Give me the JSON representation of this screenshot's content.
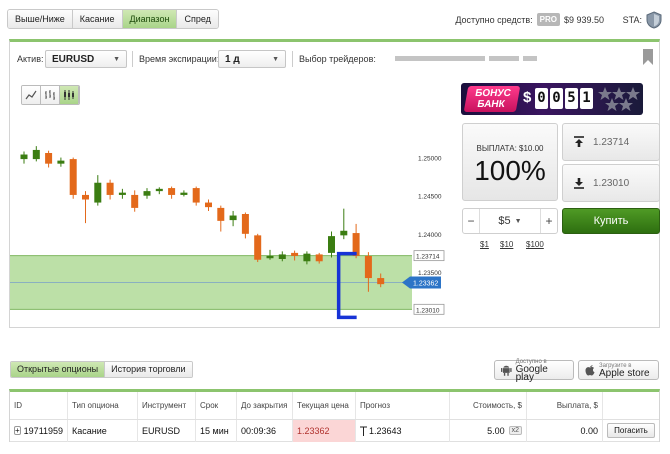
{
  "top_tabs": [
    {
      "label": "Выше/Ниже",
      "active": false
    },
    {
      "label": "Касание",
      "active": false
    },
    {
      "label": "Диапазон",
      "active": true
    },
    {
      "label": "Спред",
      "active": false
    }
  ],
  "funds": {
    "label": "Доступно средств:",
    "badge": "PRO",
    "amount": "$9 939.50"
  },
  "sta": {
    "label": "STA:"
  },
  "controls": {
    "asset_label": "Актив:",
    "asset_value": "EURUSD",
    "expiry_label": "Время экспирации:",
    "expiry_value": "1 д",
    "traders_label": "Выбор трейдеров:"
  },
  "chart_data": {
    "type": "candlestick",
    "y_ticks": [
      "1.25000",
      "1.24500",
      "1.24000",
      "1.23500"
    ],
    "ylim": [
      1.2287,
      1.2565
    ],
    "range_upper": 1.23714,
    "range_lower": 1.2301,
    "current": 1.23362,
    "candles": [
      {
        "o": 1.2498,
        "c": 1.2504,
        "h": 1.2508,
        "l": 1.2492
      },
      {
        "o": 1.2498,
        "c": 1.251,
        "h": 1.2515,
        "l": 1.2495
      },
      {
        "o": 1.2506,
        "c": 1.2492,
        "h": 1.2509,
        "l": 1.2487
      },
      {
        "o": 1.2492,
        "c": 1.2496,
        "h": 1.25,
        "l": 1.2488
      },
      {
        "o": 1.2498,
        "c": 1.2451,
        "h": 1.25,
        "l": 1.2446
      },
      {
        "o": 1.2451,
        "c": 1.2445,
        "h": 1.2456,
        "l": 1.2414
      },
      {
        "o": 1.2441,
        "c": 1.2467,
        "h": 1.2477,
        "l": 1.2437
      },
      {
        "o": 1.2467,
        "c": 1.2451,
        "h": 1.2471,
        "l": 1.2445
      },
      {
        "o": 1.2451,
        "c": 1.2454,
        "h": 1.2459,
        "l": 1.2446
      },
      {
        "o": 1.2451,
        "c": 1.2434,
        "h": 1.2457,
        "l": 1.2429
      },
      {
        "o": 1.245,
        "c": 1.2456,
        "h": 1.246,
        "l": 1.2446
      },
      {
        "o": 1.2456,
        "c": 1.2459,
        "h": 1.2461,
        "l": 1.2452
      },
      {
        "o": 1.246,
        "c": 1.2451,
        "h": 1.2462,
        "l": 1.2446
      },
      {
        "o": 1.2451,
        "c": 1.2454,
        "h": 1.2457,
        "l": 1.2449
      },
      {
        "o": 1.246,
        "c": 1.2441,
        "h": 1.2462,
        "l": 1.2437
      },
      {
        "o": 1.2441,
        "c": 1.2435,
        "h": 1.2445,
        "l": 1.243
      },
      {
        "o": 1.2434,
        "c": 1.2417,
        "h": 1.2437,
        "l": 1.2403
      },
      {
        "o": 1.2418,
        "c": 1.2424,
        "h": 1.243,
        "l": 1.241
      },
      {
        "o": 1.2426,
        "c": 1.24,
        "h": 1.2428,
        "l": 1.2394
      },
      {
        "o": 1.2398,
        "c": 1.2366,
        "h": 1.24,
        "l": 1.2363
      },
      {
        "o": 1.2368,
        "c": 1.2371,
        "h": 1.2379,
        "l": 1.2366
      },
      {
        "o": 1.2367,
        "c": 1.2373,
        "h": 1.2377,
        "l": 1.2364
      },
      {
        "o": 1.2375,
        "c": 1.2371,
        "h": 1.2378,
        "l": 1.2365
      },
      {
        "o": 1.2364,
        "c": 1.2374,
        "h": 1.2377,
        "l": 1.236
      },
      {
        "o": 1.2373,
        "c": 1.2364,
        "h": 1.2375,
        "l": 1.2361
      },
      {
        "o": 1.2375,
        "c": 1.2397,
        "h": 1.2403,
        "l": 1.2369
      },
      {
        "o": 1.2398,
        "c": 1.2404,
        "h": 1.2433,
        "l": 1.2393
      },
      {
        "o": 1.2401,
        "c": 1.2371,
        "h": 1.2413,
        "l": 1.2368
      },
      {
        "o": 1.2371,
        "c": 1.2342,
        "h": 1.2376,
        "l": 1.2324
      },
      {
        "o": 1.2342,
        "c": 1.2334,
        "h": 1.2348,
        "l": 1.233
      }
    ]
  },
  "colors": {
    "bull": "#3b7d12",
    "bear": "#e3691b",
    "zone": "#a6d689",
    "bracket": "#1733d6",
    "marker": "#2c74c7"
  },
  "promo": {
    "title_line1": "БОНУС",
    "title_line2": "БАНК",
    "dollar": "$",
    "digits": [
      "0",
      "0",
      "5",
      "1"
    ]
  },
  "payout": {
    "label": "ВЫПЛАТА: $10.00",
    "percent": "100%"
  },
  "range_buttons": {
    "upper": "1.23714",
    "lower": "1.23010"
  },
  "stake": {
    "minus": "−",
    "value": "$5",
    "plus": "+",
    "quick": [
      "$1",
      "$10",
      "$100"
    ]
  },
  "buy_label": "Купить",
  "bottom_tabs": [
    {
      "label": "Открытые опционы",
      "active": true
    },
    {
      "label": "История торговли",
      "active": false
    }
  ],
  "stores": {
    "google_small": "Доступно в",
    "google": "Google play",
    "apple_small": "Загрузите в",
    "apple": "Apple store"
  },
  "table": {
    "headers": [
      "ID",
      "Тип опциона",
      "Инструмент",
      "Срок",
      "До закрытия",
      "Текущая цена",
      "Прогноз",
      "Стоимость, $",
      "Выплата, $",
      ""
    ],
    "row": {
      "expand": "+",
      "id": "19711959",
      "type": "Касание",
      "instrument": "EURUSD",
      "term": "15 мин",
      "remaining": "00:09:36",
      "current": "1.23362",
      "forecast": "1.23643",
      "cost": "5.00",
      "mult": "x2",
      "payout": "0.00",
      "action": "Погасить"
    }
  }
}
